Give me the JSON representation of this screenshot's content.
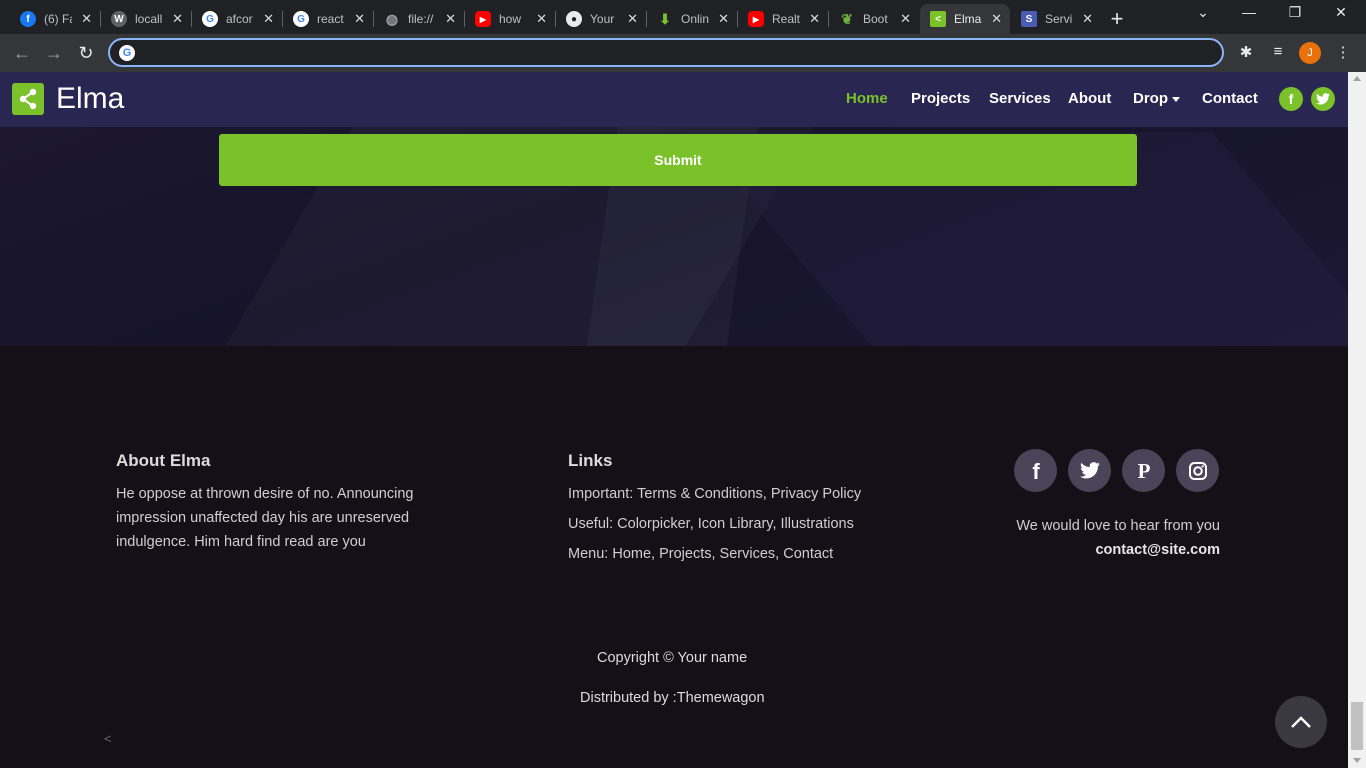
{
  "browser": {
    "tabs": [
      {
        "title": "(6) Fa",
        "icon": "facebook-icon",
        "color": "#1877f2",
        "glyph": "f"
      },
      {
        "title": "locall",
        "icon": "wordpress-icon",
        "color": "#5f6368",
        "glyph": "W"
      },
      {
        "title": "afcor",
        "icon": "google-icon",
        "color": "#ffffff",
        "glyph": "G"
      },
      {
        "title": "react",
        "icon": "google-icon",
        "color": "#ffffff",
        "glyph": "G"
      },
      {
        "title": "file://",
        "icon": "globe-icon",
        "color": "#9aa0a6",
        "glyph": "◍"
      },
      {
        "title": "how",
        "icon": "youtube-icon",
        "color": "#ff0000",
        "glyph": "▶"
      },
      {
        "title": "Your",
        "icon": "github-icon",
        "color": "#e8eaed",
        "glyph": "●"
      },
      {
        "title": "Onlin",
        "icon": "download-icon",
        "color": "#7bc12a",
        "glyph": "⬇"
      },
      {
        "title": "Realt",
        "icon": "youtube-icon",
        "color": "#ff0000",
        "glyph": "▶"
      },
      {
        "title": "Boot",
        "icon": "leaf-icon",
        "color": "#6db33f",
        "glyph": "❦"
      },
      {
        "title": "Elma",
        "icon": "share-icon",
        "color": "#7bc12a",
        "glyph": "<",
        "active": true
      },
      {
        "title": "Servi",
        "icon": "s-icon",
        "color": "#4a5bb5",
        "glyph": "S"
      }
    ],
    "address": "",
    "profile_initial": "J"
  },
  "site": {
    "brand": "Elma",
    "accent": "#7bc12a",
    "nav": [
      "Home",
      "Projects",
      "Services",
      "About",
      "Drop",
      "Contact"
    ],
    "submit_label": "Submit"
  },
  "footer": {
    "about_title": "About Elma",
    "about_text": "He oppose at thrown desire of no. Announcing impression unaffected day his are unreserved indulgence. Him hard find read are you",
    "links_title": "Links",
    "important_label": "Important:",
    "important_links": [
      "Terms & Conditions,",
      "Privacy Policy"
    ],
    "useful_label": "Useful:",
    "useful_links": [
      "Colorpicker,",
      "Icon Library,",
      "Illustrations"
    ],
    "menu_label": "Menu:",
    "menu_links": [
      "Home,",
      "Projects,",
      "Services,",
      "Contact"
    ],
    "contact_line": "We would love to hear from you",
    "contact_email": "contact@site.com",
    "copyright": "Copyright © Your name",
    "distributed": "Distributed by :Themewagon"
  }
}
